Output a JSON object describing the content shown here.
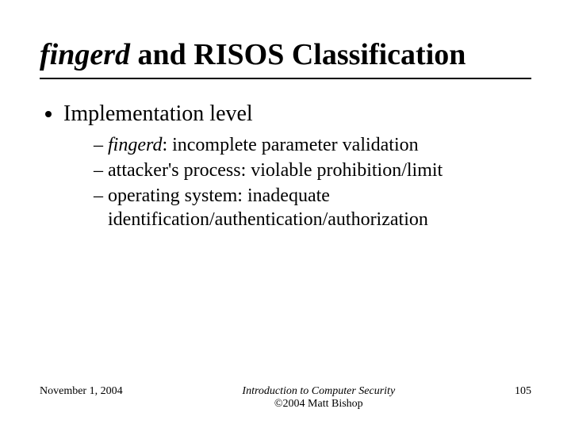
{
  "title": {
    "italic_part": "fingerd",
    "rest": " and RISOS Classification"
  },
  "bullets": {
    "item1": "Implementation level",
    "sub1_prefix": "fingerd",
    "sub1_rest": ": incomplete parameter validation",
    "sub2": "attacker's process: violable prohibition/limit",
    "sub3": "operating system: inadequate identification/authentication/authorization"
  },
  "footer": {
    "date": "November 1, 2004",
    "center_line1": "Introduction to Computer Security",
    "center_line2": "©2004 Matt Bishop",
    "page": "105"
  }
}
